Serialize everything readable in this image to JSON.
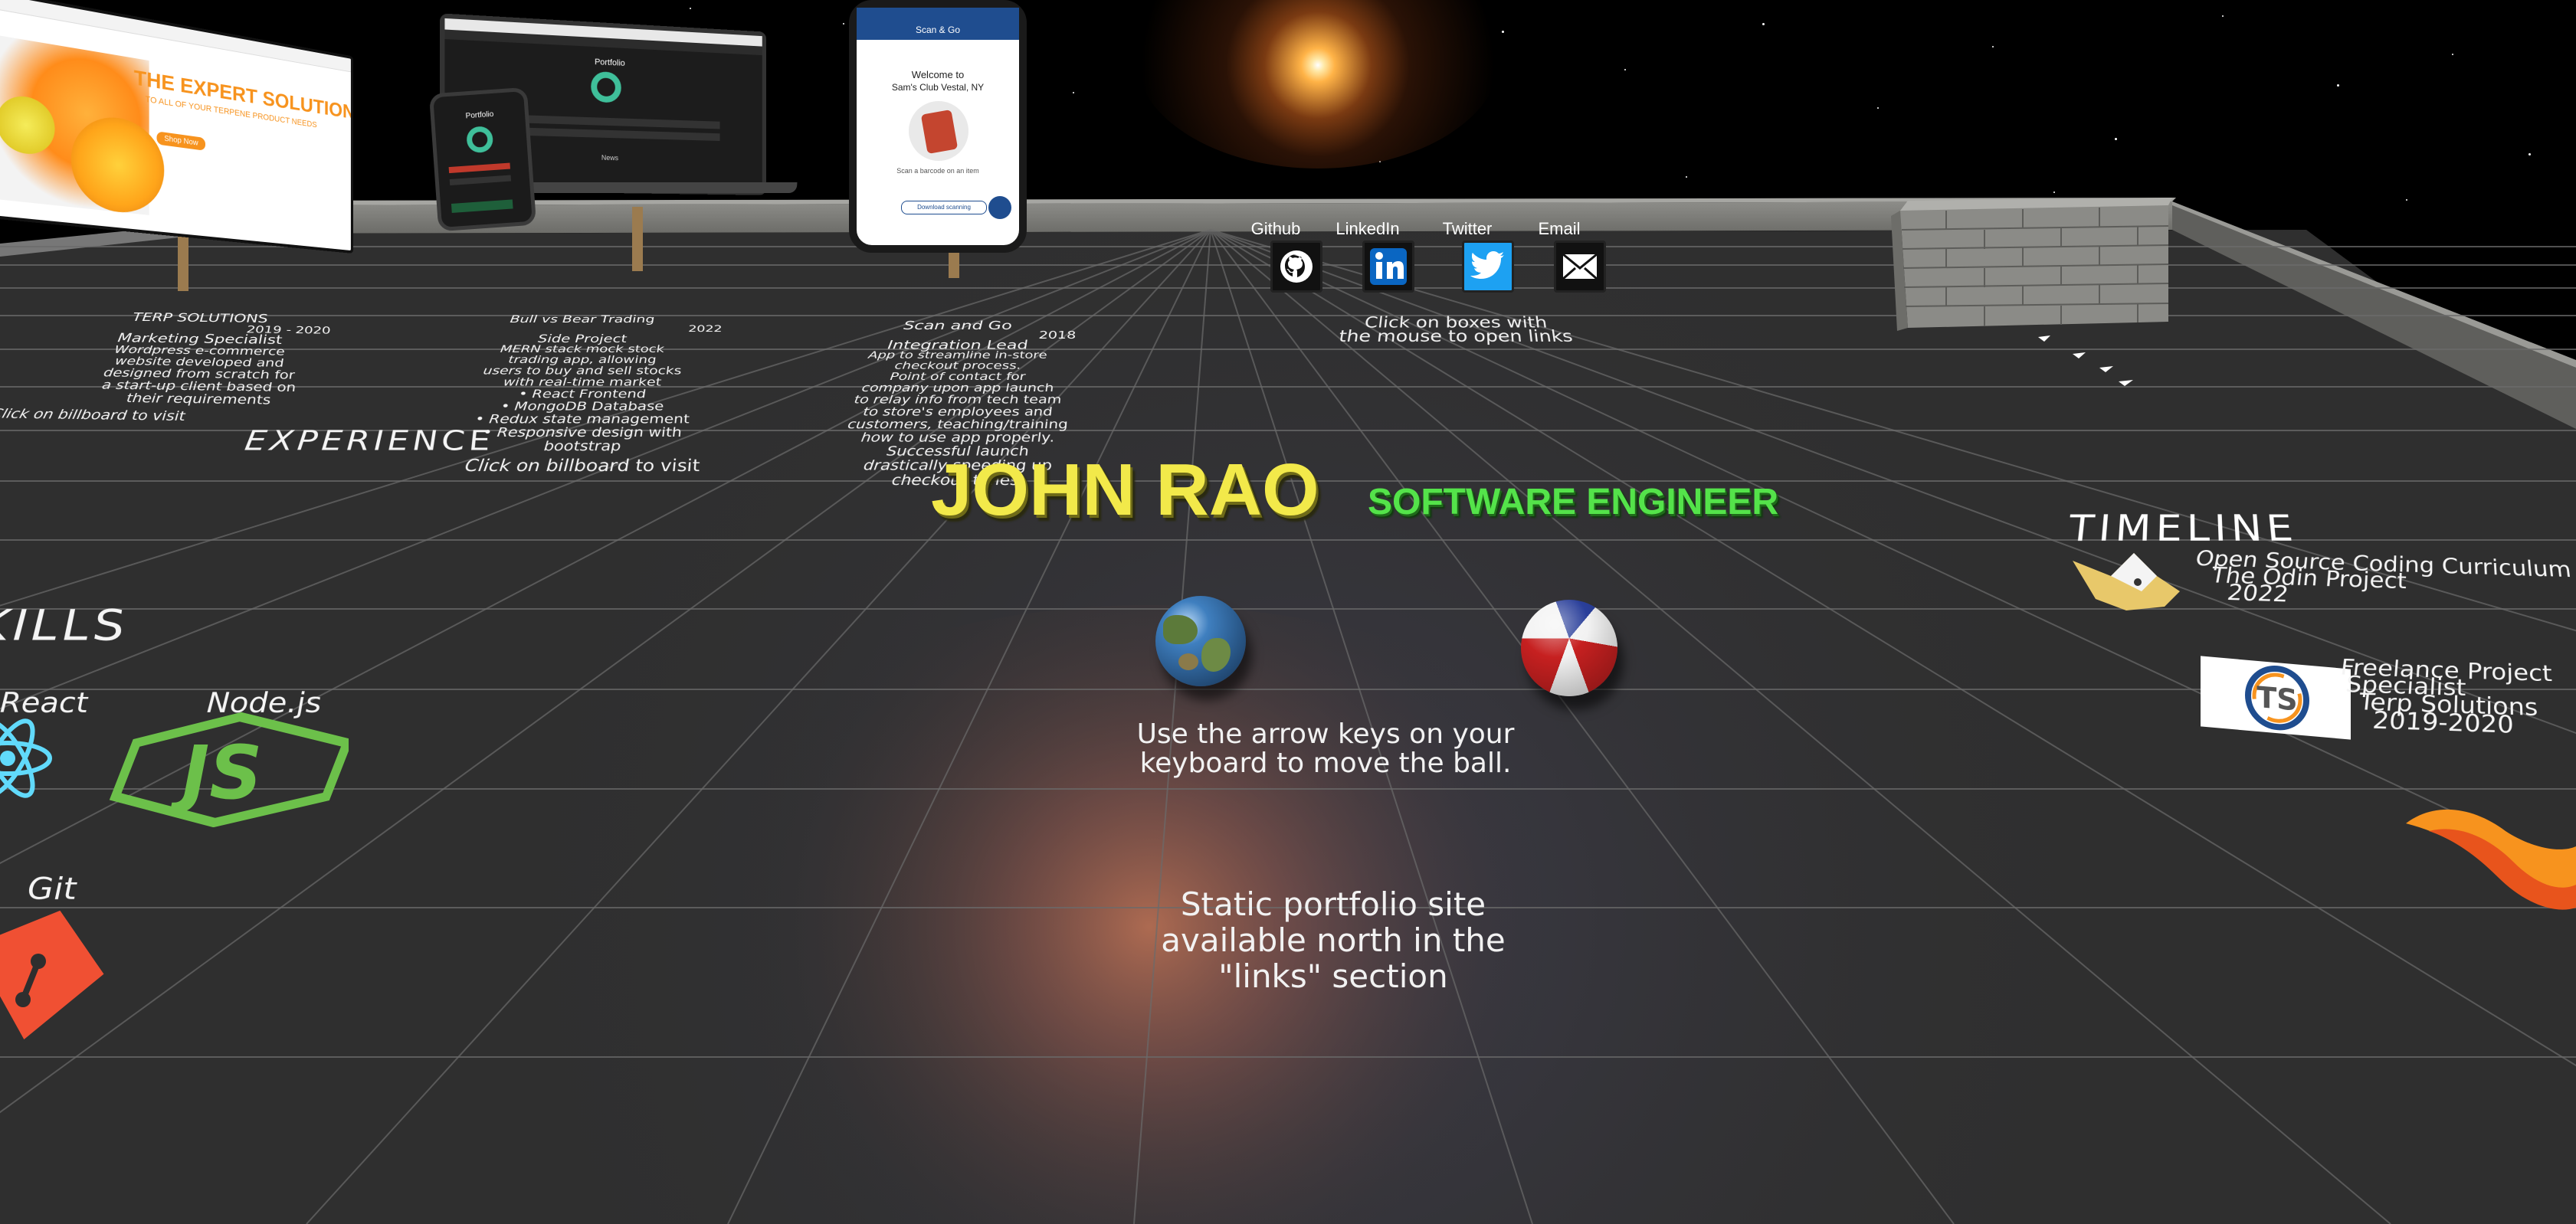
{
  "title": {
    "name": "JOHN RAO",
    "role": "SOFTWARE ENGINEER"
  },
  "sections": {
    "experience": "EXPERIENCE",
    "skills": "KILLS",
    "timeline": "TIMELINE"
  },
  "links": {
    "items": [
      {
        "label": "Github",
        "icon": "github-icon"
      },
      {
        "label": "LinkedIn",
        "icon": "linkedin-icon"
      },
      {
        "label": "Twitter",
        "icon": "twitter-icon"
      },
      {
        "label": "Email",
        "icon": "email-icon"
      }
    ],
    "hint_line1": "Click on boxes with",
    "hint_line2": "the mouse to open links"
  },
  "instructions": {
    "line1": "Use the arrow keys on your",
    "line2": "keyboard to move the ball.",
    "static_line1": "Static portfolio site",
    "static_line2": "available north in the",
    "static_line3": "\"links\" section"
  },
  "experience": {
    "terp": {
      "company": "TERP SOLUTIONS",
      "date": "2019 - 2020",
      "role": "Marketing Specialist",
      "desc": [
        "Wordpress e-commerce",
        "website developed and",
        "designed from scratch for",
        "a start-up client based on",
        "their requirements"
      ],
      "cta": "Click on billboard to visit",
      "billboard_headline": "THE EXPERT SOLUTION",
      "billboard_sub": "TO ALL OF YOUR TERPENE PRODUCT NEEDS",
      "billboard_button": "Shop Now"
    },
    "portfolio": {
      "company": "Bull vs Bear Trading",
      "date": "2022",
      "role": "Side Project",
      "desc": [
        "MERN stack mock stock",
        "trading app, allowing",
        "users to buy and sell stocks",
        "with real-time market",
        "• React Frontend",
        "• MongoDB Database",
        "• Redux state management",
        "• Responsive design with",
        "bootstrap"
      ],
      "cta": "Click on billboard to visit",
      "screen_title": "Portfolio",
      "screen_sub": "News"
    },
    "scan": {
      "company": "Scan and Go",
      "date": "2018",
      "role": "Integration Lead",
      "desc": [
        "App to streamline in-store",
        "checkout process.",
        "Point of contact for",
        "company upon app launch",
        "to relay info from tech team",
        "to store's employees and",
        "customers, teaching/training",
        "how to use app properly.",
        "Successful launch",
        "drastically speeding up",
        "checkout times."
      ],
      "phone_brand": "Scan & Go",
      "phone_welcome1": "Welcome to",
      "phone_welcome2": "Sam's Club Vestal, NY",
      "phone_hint": "Scan a barcode on an item",
      "phone_button": "Download scanning"
    }
  },
  "skills": [
    {
      "label": "React",
      "icon": "react-icon"
    },
    {
      "label": "Node.js",
      "icon": "nodejs-icon"
    },
    {
      "label": "Git",
      "icon": "git-icon"
    }
  ],
  "timeline": [
    {
      "line1": "Open Source Coding Curriculum",
      "line2": "The Odin Project",
      "line3": "2022",
      "icon": "odin-project-icon"
    },
    {
      "line1": "Freelance Project",
      "line2": "Specialist",
      "line3": "Terp Solutions",
      "line4": "2019-2020",
      "logo_text": "TS",
      "icon": "terp-solutions-logo"
    },
    {
      "icon": "phoenix-icon"
    }
  ],
  "colors": {
    "name": "#f2e94a",
    "role": "#54e34a",
    "floor": "#2e2e2e",
    "grid": "#6a6a6a",
    "wall": "#7c7c78",
    "accent_orange": "#f7931e"
  }
}
